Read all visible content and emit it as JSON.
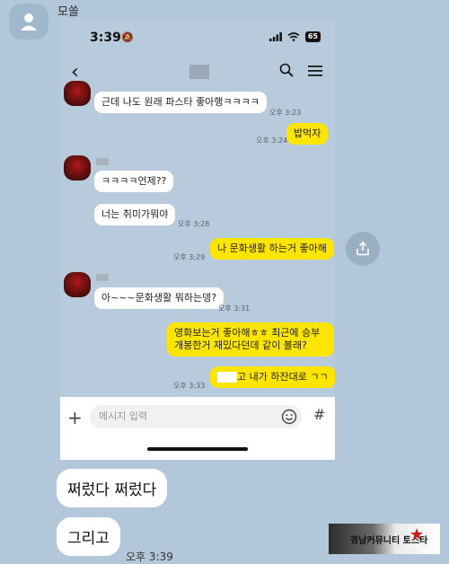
{
  "outer": {
    "sender_name": "모쏠",
    "messages": [
      {
        "text": "쩌렀다 쩌렀다"
      },
      {
        "text": "그리고"
      }
    ],
    "last_time": "오후 3:39"
  },
  "phone": {
    "status": {
      "time": "3:39",
      "battery": "65"
    },
    "chat": {
      "messages": [
        {
          "side": "friend",
          "text": "근데 나도 원래 파스타 좋아행ㅋㅋㅋㅋ",
          "time": "오후 3:23"
        },
        {
          "side": "me",
          "text": "밥먹자",
          "time": "오후 3:24"
        },
        {
          "side": "friend",
          "text": "ㅋㅋㅋㅋ언제??"
        },
        {
          "side": "friend",
          "text": "너는 취미가뭐야",
          "time": "오후 3:28"
        },
        {
          "side": "me",
          "text": "나 문화생활 하는거 좋아해",
          "time": "오후 3:29"
        },
        {
          "side": "friend",
          "text": "아~~~문화생활 뭐하는뎅?",
          "time": "오후 3:31"
        },
        {
          "side": "me",
          "text": "영화보는거 좋아해ㅎㅎ 최근에 승부 개봉한거 재밌다던데 같이 볼래?"
        },
        {
          "side": "me",
          "text": "고 내가 하잔대로 ㄱㄱ",
          "time": "오후 3:33"
        }
      ]
    },
    "input": {
      "placeholder": "메시지 입력"
    }
  },
  "watermark": {
    "text": "경남커뮤니티 토스타"
  },
  "icons": {
    "back": "back-arrow-icon",
    "search": "search-icon",
    "menu": "hamburger-menu-icon",
    "plus": "plus-icon",
    "emoji": "emoji-icon",
    "hash": "hash-icon",
    "share": "share-icon"
  },
  "colors": {
    "my_bubble": "#fee500",
    "chat_bg": "#b7cbdc",
    "friend_bubble": "#ffffff"
  }
}
